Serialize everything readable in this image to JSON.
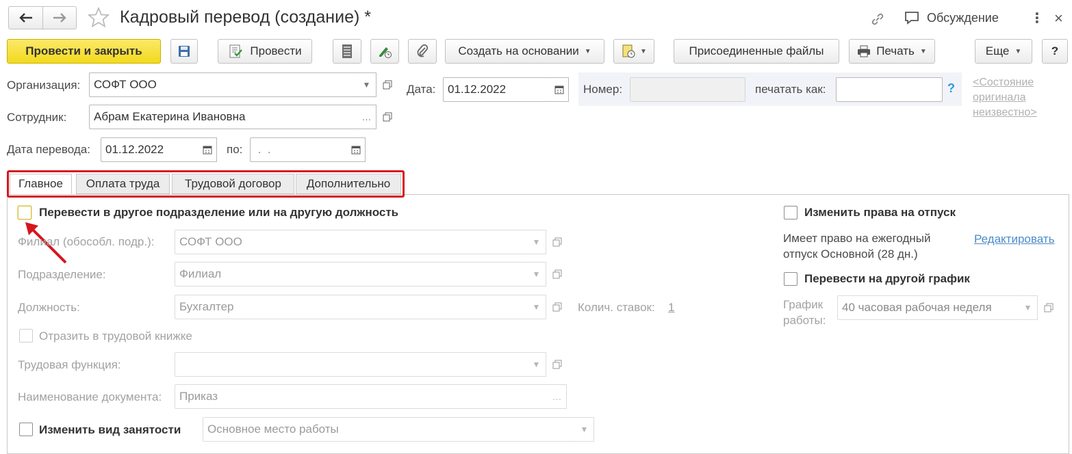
{
  "window": {
    "title": "Кадровый перевод (создание) *",
    "discussion_label": "Обсуждение"
  },
  "toolbar": {
    "post_close": "Провести и закрыть",
    "post": "Провести",
    "create_based": "Создать на основании",
    "attached_files": "Присоединенные файлы",
    "print": "Печать",
    "more": "Еще",
    "help": "?"
  },
  "header": {
    "org_label": "Организация:",
    "org_value": "СОФТ ООО",
    "date_label": "Дата:",
    "date_value": "01.12.2022",
    "number_label": "Номер:",
    "number_value": "",
    "print_as_label": "печатать как:",
    "print_as_value": "",
    "help_q": "?",
    "status_link": "<Состояние оригинала неизвестно>",
    "employee_label": "Сотрудник:",
    "employee_value": "Абрам Екатерина Ивановна",
    "transfer_date_label": "Дата перевода:",
    "transfer_date_value": "01.12.2022",
    "to_label": "по:",
    "to_value": " .  ."
  },
  "tabs": [
    {
      "label": "Главное",
      "active": true
    },
    {
      "label": "Оплата труда",
      "active": false
    },
    {
      "label": "Трудовой договор",
      "active": false
    },
    {
      "label": "Дополнительно",
      "active": false
    }
  ],
  "main": {
    "transfer_checkbox_label": "Перевести в другое подразделение или на другую должность",
    "branch_label": "Филиал (обособл. подр.):",
    "branch_value": "СОФТ ООО",
    "division_label": "Подразделение:",
    "division_value": "Филиал",
    "position_label": "Должность:",
    "position_value": "Бухгалтер",
    "rates_label": "Колич. ставок:",
    "rates_value": "1",
    "workbook_label": "Отразить в трудовой книжке",
    "labor_function_label": "Трудовая функция:",
    "labor_function_value": "",
    "doc_name_label": "Наименование документа:",
    "doc_name_value": "Приказ",
    "employment_type_label": "Изменить вид занятости",
    "employment_type_value": "Основное место работы"
  },
  "right": {
    "vacation_label": "Изменить права на отпуск",
    "vacation_info": "Имеет право на ежегодный отпуск Основной (28 дн.)",
    "edit_link": "Редактировать",
    "schedule_checkbox_label": "Перевести на другой график",
    "schedule_label": "График работы:",
    "schedule_value": "40 часовая рабочая неделя"
  },
  "colors": {
    "primary_button": "#f3d91c",
    "highlight_red": "#d6161c",
    "link": "#4a8bc9"
  }
}
